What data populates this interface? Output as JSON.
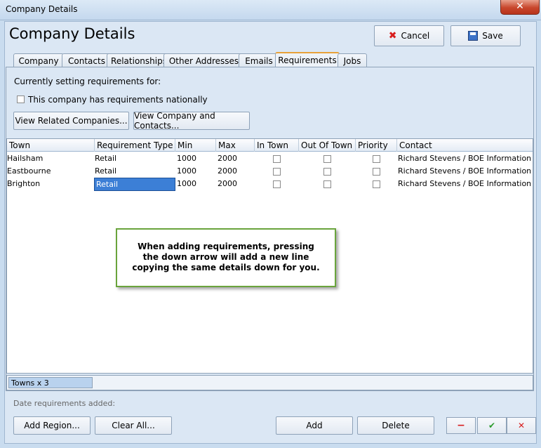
{
  "window": {
    "title": "Company Details",
    "close_glyph": "✕"
  },
  "header": {
    "title": "Company Details",
    "cancel_label": "Cancel",
    "save_label": "Save"
  },
  "tabs": [
    {
      "label": "Company"
    },
    {
      "label": "Contacts"
    },
    {
      "label": "Relationships"
    },
    {
      "label": "Other Addresses"
    },
    {
      "label": "Emails"
    },
    {
      "label": "Requirements"
    },
    {
      "label": "Jobs"
    }
  ],
  "active_tab": "Requirements",
  "requirements": {
    "setting_label": "Currently setting requirements for:",
    "national_label": "This company has requirements nationally",
    "national_checked": false,
    "view_related_label": "View Related Companies...",
    "view_company_label": "View Company and Contacts..."
  },
  "grid": {
    "columns": [
      "Town",
      "Requirement Type",
      "Min",
      "Max",
      "In Town",
      "Out Of Town",
      "Priority",
      "Contact"
    ],
    "rows": [
      {
        "town": "Hailsham",
        "type": "Retail",
        "min": "1000",
        "max": "2000",
        "in_town": false,
        "out_of_town": false,
        "priority": false,
        "contact": "Richard Stevens / BOE Information Syst"
      },
      {
        "town": "Eastbourne",
        "type": "Retail",
        "min": "1000",
        "max": "2000",
        "in_town": false,
        "out_of_town": false,
        "priority": false,
        "contact": "Richard Stevens / BOE Information Syst"
      },
      {
        "town": "Brighton",
        "type": "Retail",
        "min": "1000",
        "max": "2000",
        "in_town": false,
        "out_of_town": false,
        "priority": false,
        "contact": "Richard Stevens / BOE Information Syst"
      }
    ],
    "footer_summary": "Towns x 3"
  },
  "callout": {
    "text": "When adding requirements, pressing the down arrow will add a new line copying the same details down for you."
  },
  "bottom": {
    "date_added_label": "Date requirements added:",
    "add_region_label": "Add Region...",
    "clear_all_label": "Clear All...",
    "add_label": "Add",
    "delete_label": "Delete",
    "minus_glyph": "−",
    "check_glyph": "✔",
    "cross_glyph": "✕"
  },
  "colors": {
    "accent_tab": "#e8a23a",
    "selection": "#3c7fd6",
    "callout_border": "#6aa43c",
    "minus_red": "#d81e1e",
    "check_green": "#2a9a2a"
  }
}
